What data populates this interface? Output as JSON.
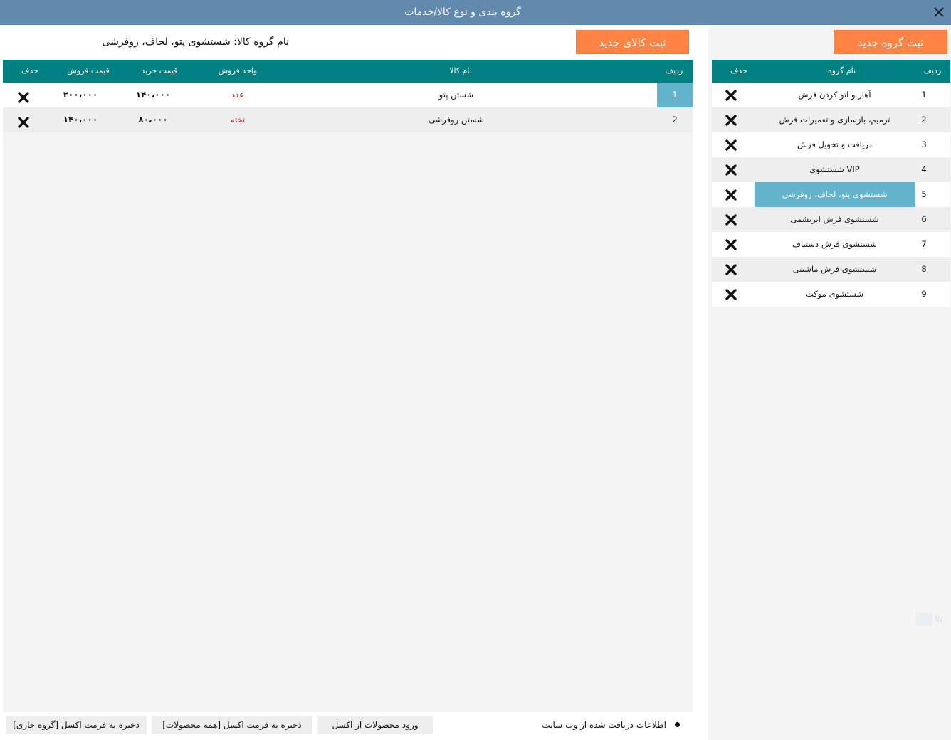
{
  "window": {
    "title": "گروه بندی و نوع کالا/خدمات"
  },
  "groups": {
    "new_button": "ثبت گروه جدید",
    "headers": {
      "row": "ردیف",
      "name": "نام گروه",
      "delete": "حذف"
    },
    "selected_index": 4,
    "rows": [
      {
        "num": "1",
        "name": "آهار و اتو کردن فرش"
      },
      {
        "num": "2",
        "name": "ترمیم، بازسازی و تعمیرات فرش"
      },
      {
        "num": "3",
        "name": "دریافت و تحویل فرش"
      },
      {
        "num": "4",
        "name": "شستشوی VIP"
      },
      {
        "num": "5",
        "name": "شستشوی پتو، لحاف، روفرشی"
      },
      {
        "num": "6",
        "name": "شستشوی فرش ابریشمی"
      },
      {
        "num": "7",
        "name": "شستشوی فرش دستباف"
      },
      {
        "num": "8",
        "name": "شستشوی فرش ماشینی"
      },
      {
        "num": "9",
        "name": "شستشوی موکت"
      }
    ]
  },
  "products": {
    "new_button": "ثبت کالای جدید",
    "group_label": "نام گروه کالا: شستشوی پتو، لحاف، روفرشی",
    "headers": {
      "row": "ردیف",
      "name": "نام کالا",
      "unit": "واحد فروش",
      "buy": "قیمت خرید",
      "sell": "قیمت فروش",
      "delete": "حذف"
    },
    "rows": [
      {
        "num": "1",
        "name": "شستن پتو",
        "unit": "عدد",
        "buy": "۱۴۰،۰۰۰",
        "sell": "۲۰۰،۰۰۰"
      },
      {
        "num": "2",
        "name": "شستن روفرشی",
        "unit": "تخته",
        "buy": "۸۰،۰۰۰",
        "sell": "۱۴۰،۰۰۰"
      }
    ]
  },
  "footer": {
    "web_info": "اطلاعات دریافت شده از وب سایت",
    "import_excel": "ورود محصولات از اکسل",
    "save_all": "ذخیره به فرمت اکسل [همه محصولات]",
    "save_current": "ذخیره به فرمت اکسل [گروه جاری]"
  },
  "colors": {
    "titlebar": "#6189ae",
    "accent": "#fd8445",
    "header": "#008080",
    "selected": "#62b3cb"
  },
  "icons": {
    "close": "close-icon",
    "delete": "delete-x-icon"
  }
}
